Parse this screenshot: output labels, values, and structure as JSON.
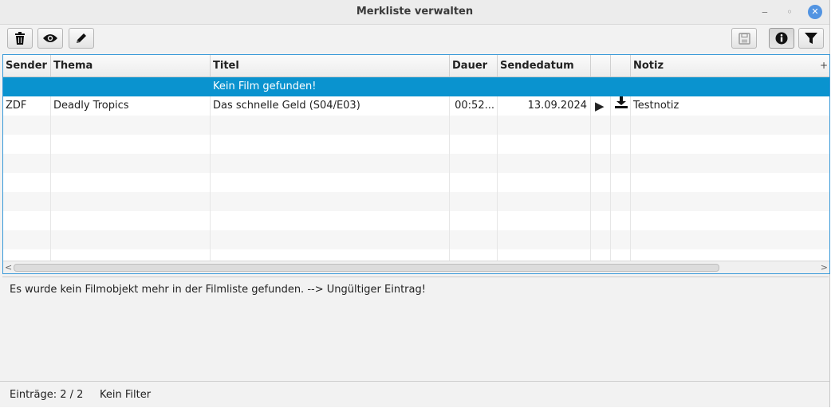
{
  "window": {
    "title": "Merkliste verwalten",
    "minimize": "‒",
    "maximize": "◦",
    "close": "✕"
  },
  "toolbar": {
    "left": [
      {
        "name": "delete-button",
        "icon": "trash-icon"
      },
      {
        "name": "view-button",
        "icon": "eye-icon"
      },
      {
        "name": "edit-button",
        "icon": "pencil-icon"
      }
    ],
    "right": [
      {
        "name": "save-button",
        "icon": "save-icon",
        "enabled": false
      },
      {
        "name": "info-button",
        "icon": "info-icon",
        "pressed": true
      },
      {
        "name": "filter-button",
        "icon": "filter-icon"
      }
    ]
  },
  "table": {
    "columns": [
      "Sender",
      "Thema",
      "Titel",
      "Dauer",
      "Sendedatum",
      "",
      "",
      "Notiz"
    ],
    "add_column": "+",
    "rows": [
      {
        "sender": "",
        "thema": "",
        "titel": "Kein Film gefunden!",
        "dauer": "",
        "datum": "",
        "play": "",
        "download": "",
        "notiz": "",
        "selected": true
      },
      {
        "sender": "ZDF",
        "thema": "Deadly Tropics",
        "titel": "Das schnelle Geld (S04/E03)",
        "dauer": "00:52...",
        "datum": "13.09.2024",
        "play": "▶",
        "download": "download-icon",
        "notiz": "Testnotiz",
        "selected": false
      }
    ],
    "scroll_left": "<",
    "scroll_right": ">"
  },
  "detail": {
    "text": "Es wurde kein Filmobjekt mehr in der Filmliste gefunden. --> Ungültiger Eintrag!"
  },
  "status": {
    "entries": "Einträge: 2 / 2",
    "filter": "Kein Filter"
  },
  "colors": {
    "selection": "#0a93cf",
    "accent": "#3a9ad9",
    "close_button": "#5294e2"
  }
}
